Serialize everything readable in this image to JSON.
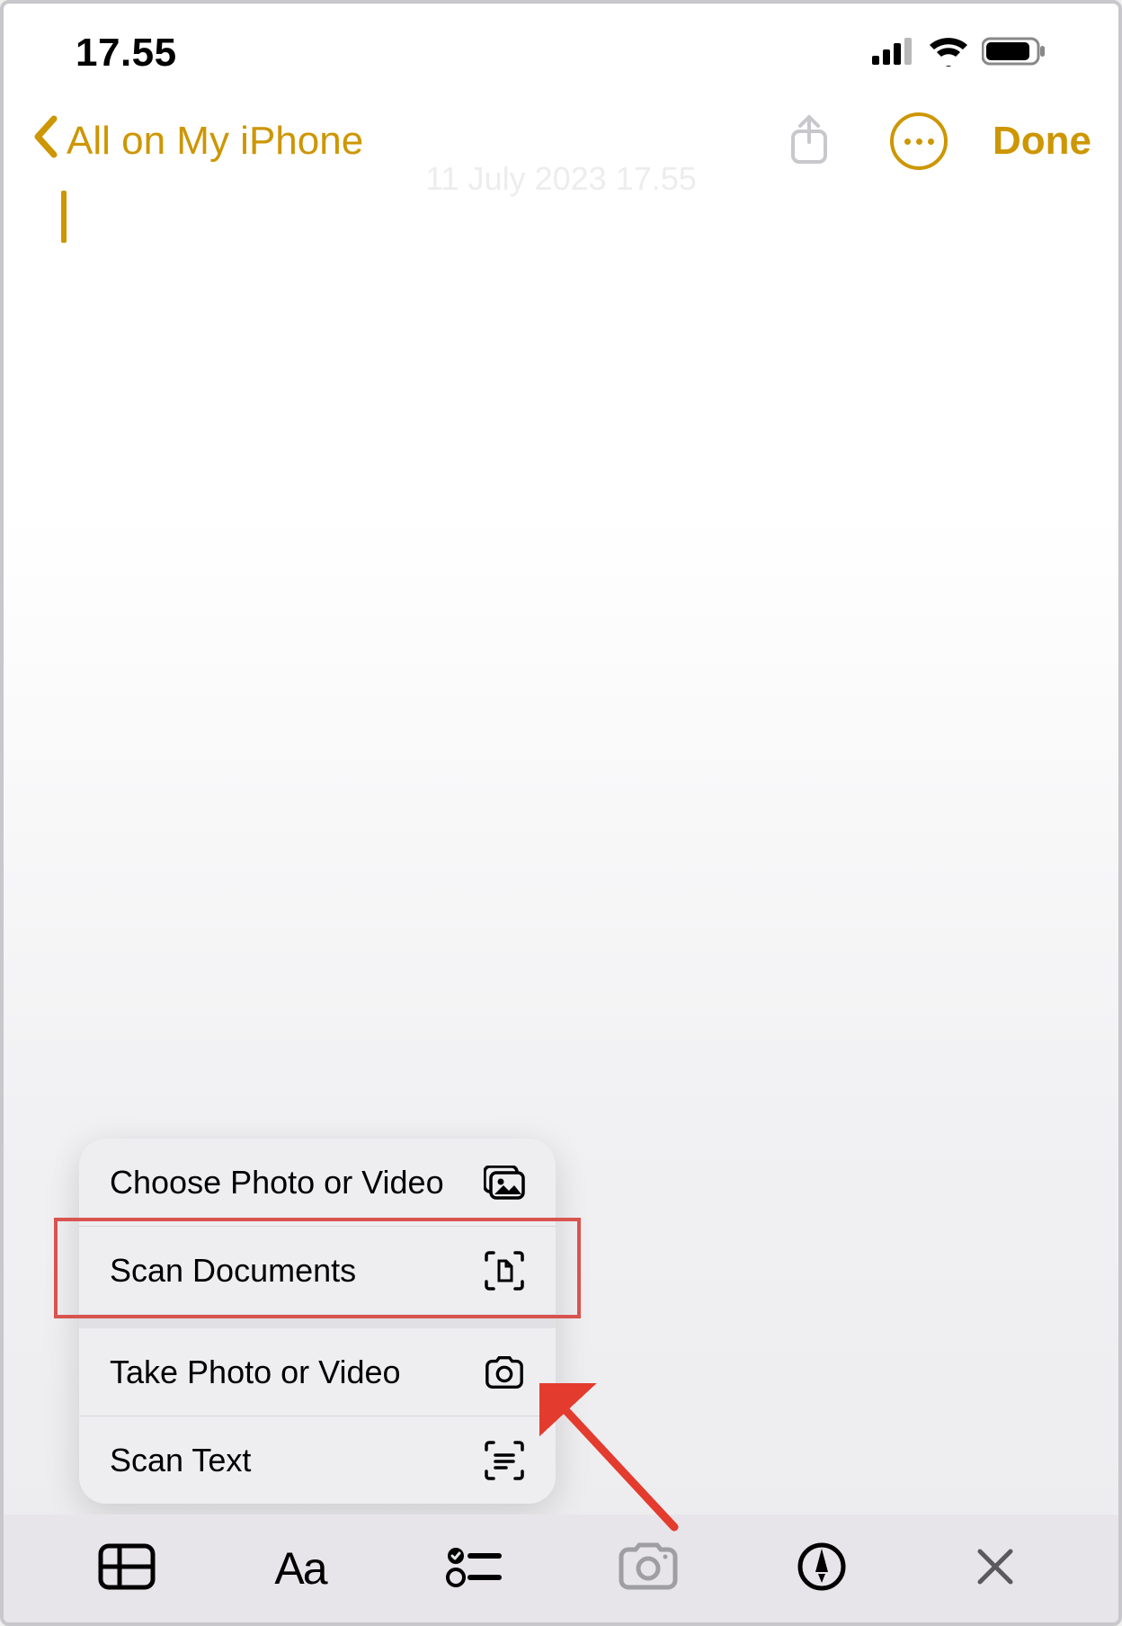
{
  "status": {
    "time": "17.55"
  },
  "nav": {
    "back_label": "All on My iPhone",
    "done_label": "Done"
  },
  "note": {
    "date_header": "11 July 2023 17.55"
  },
  "camera_menu": {
    "items": [
      {
        "label": "Choose Photo or Video",
        "icon": "photo-library-icon"
      },
      {
        "label": "Scan Documents",
        "icon": "scan-document-icon"
      },
      {
        "label": "Take Photo or Video",
        "icon": "camera-icon"
      },
      {
        "label": "Scan Text",
        "icon": "scan-text-icon"
      }
    ],
    "highlighted_index": 1
  },
  "toolbar": {
    "items": [
      "table",
      "text-format",
      "checklist",
      "camera",
      "markup",
      "close"
    ],
    "active_index": 3
  },
  "annotation": {
    "type": "arrow",
    "target": "toolbar-camera",
    "color": "#d9534f"
  }
}
